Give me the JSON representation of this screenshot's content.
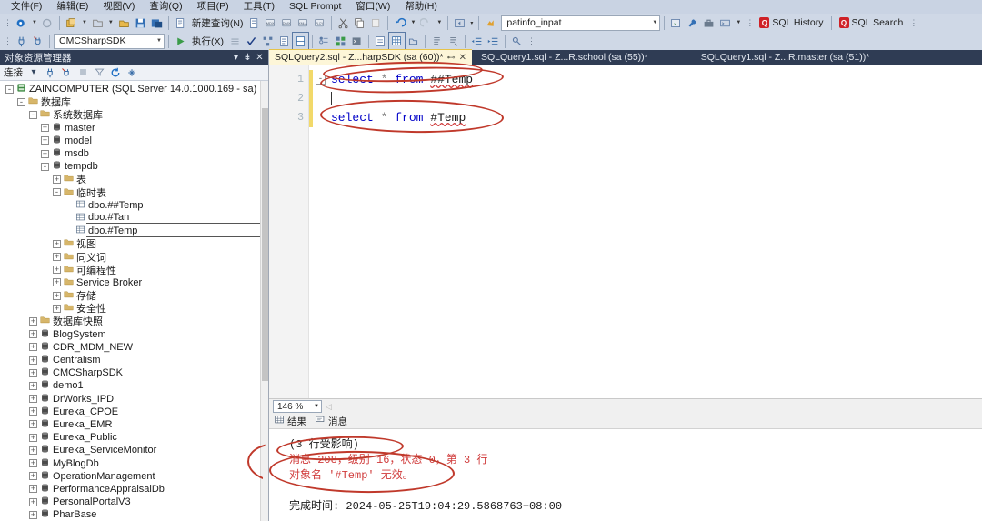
{
  "menubar": {
    "items": [
      {
        "label": "文件(F)",
        "name": "menu-file"
      },
      {
        "label": "编辑(E)",
        "name": "menu-edit"
      },
      {
        "label": "视图(V)",
        "name": "menu-view"
      },
      {
        "label": "查询(Q)",
        "name": "menu-query"
      },
      {
        "label": "项目(P)",
        "name": "menu-project"
      },
      {
        "label": "工具(T)",
        "name": "menu-tools"
      },
      {
        "label": "SQL Prompt",
        "name": "menu-sql-prompt"
      },
      {
        "label": "窗口(W)",
        "name": "menu-window"
      },
      {
        "label": "帮助(H)",
        "name": "menu-help"
      }
    ]
  },
  "toolbar1": {
    "new_query_label": "新建查询(N)",
    "db_combo_value": "patinfo_inpat",
    "sql_history_label": "SQL History",
    "sql_search_label": "SQL Search",
    "sql_badge": "Q"
  },
  "toolbar2": {
    "db_combo_value": "CMCSharpSDK",
    "execute_label": "执行(X)"
  },
  "object_explorer": {
    "title": "对象资源管理器",
    "connect_label": "连接",
    "tree": [
      {
        "indent": 0,
        "expander": "-",
        "icon": "server-icon",
        "label": "ZAINCOMPUTER (SQL Server 14.0.1000.169 - sa)",
        "kind": "srv"
      },
      {
        "indent": 1,
        "expander": "-",
        "icon": "folder-icon",
        "label": "数据库",
        "kind": "fld"
      },
      {
        "indent": 2,
        "expander": "-",
        "icon": "folder-icon",
        "label": "系统数据库",
        "kind": "fld"
      },
      {
        "indent": 3,
        "expander": "+",
        "icon": "database-icon",
        "label": "master",
        "kind": "db"
      },
      {
        "indent": 3,
        "expander": "+",
        "icon": "database-icon",
        "label": "model",
        "kind": "db"
      },
      {
        "indent": 3,
        "expander": "+",
        "icon": "database-icon",
        "label": "msdb",
        "kind": "db"
      },
      {
        "indent": 3,
        "expander": "-",
        "icon": "database-icon",
        "label": "tempdb",
        "kind": "db"
      },
      {
        "indent": 4,
        "expander": "+",
        "icon": "folder-icon",
        "label": "表",
        "kind": "fld"
      },
      {
        "indent": 4,
        "expander": "-",
        "icon": "folder-icon",
        "label": "临时表",
        "kind": "fld"
      },
      {
        "indent": 5,
        "expander": "",
        "icon": "table-icon",
        "label": "dbo.##Temp",
        "kind": "tbl"
      },
      {
        "indent": 5,
        "expander": "",
        "icon": "table-icon",
        "label": "dbo.#Tan",
        "kind": "tbl",
        "underline": true
      },
      {
        "indent": 5,
        "expander": "",
        "icon": "table-icon",
        "label": "dbo.#Temp",
        "kind": "tbl",
        "underline": true
      },
      {
        "indent": 4,
        "expander": "+",
        "icon": "folder-icon",
        "label": "视图",
        "kind": "fld"
      },
      {
        "indent": 4,
        "expander": "+",
        "icon": "folder-icon",
        "label": "同义词",
        "kind": "fld"
      },
      {
        "indent": 4,
        "expander": "+",
        "icon": "folder-icon",
        "label": "可编程性",
        "kind": "fld"
      },
      {
        "indent": 4,
        "expander": "+",
        "icon": "folder-icon",
        "label": "Service Broker",
        "kind": "fld"
      },
      {
        "indent": 4,
        "expander": "+",
        "icon": "folder-icon",
        "label": "存储",
        "kind": "fld"
      },
      {
        "indent": 4,
        "expander": "+",
        "icon": "folder-icon",
        "label": "安全性",
        "kind": "fld"
      },
      {
        "indent": 2,
        "expander": "+",
        "icon": "folder-icon",
        "label": "数据库快照",
        "kind": "fld"
      },
      {
        "indent": 2,
        "expander": "+",
        "icon": "database-icon",
        "label": "BlogSystem",
        "kind": "db"
      },
      {
        "indent": 2,
        "expander": "+",
        "icon": "database-icon",
        "label": "CDR_MDM_NEW",
        "kind": "db"
      },
      {
        "indent": 2,
        "expander": "+",
        "icon": "database-icon",
        "label": "Centralism",
        "kind": "db"
      },
      {
        "indent": 2,
        "expander": "+",
        "icon": "database-icon",
        "label": "CMCSharpSDK",
        "kind": "db"
      },
      {
        "indent": 2,
        "expander": "+",
        "icon": "database-icon",
        "label": "demo1",
        "kind": "db"
      },
      {
        "indent": 2,
        "expander": "+",
        "icon": "database-icon",
        "label": "DrWorks_IPD",
        "kind": "db"
      },
      {
        "indent": 2,
        "expander": "+",
        "icon": "database-icon",
        "label": "Eureka_CPOE",
        "kind": "db"
      },
      {
        "indent": 2,
        "expander": "+",
        "icon": "database-icon",
        "label": "Eureka_EMR",
        "kind": "db"
      },
      {
        "indent": 2,
        "expander": "+",
        "icon": "database-icon",
        "label": "Eureka_Public",
        "kind": "db"
      },
      {
        "indent": 2,
        "expander": "+",
        "icon": "database-icon",
        "label": "Eureka_ServiceMonitor",
        "kind": "db"
      },
      {
        "indent": 2,
        "expander": "+",
        "icon": "database-icon",
        "label": "MyBlogDb",
        "kind": "db"
      },
      {
        "indent": 2,
        "expander": "+",
        "icon": "database-icon",
        "label": "OperationManagement",
        "kind": "db"
      },
      {
        "indent": 2,
        "expander": "+",
        "icon": "database-icon",
        "label": "PerformanceAppraisalDb",
        "kind": "db"
      },
      {
        "indent": 2,
        "expander": "+",
        "icon": "database-icon",
        "label": "PersonalPortalV3",
        "kind": "db"
      },
      {
        "indent": 2,
        "expander": "+",
        "icon": "database-icon",
        "label": "PharBase",
        "kind": "db"
      }
    ]
  },
  "tabs": [
    {
      "label": "SQLQuery2.sql - Z...harpSDK (sa (60))*",
      "active": true,
      "name": "tab-sqlquery2"
    },
    {
      "label": "SQLQuery1.sql - Z...R.school (sa (55))*",
      "active": false,
      "name": "tab-sqlquery1-school"
    },
    {
      "label": "SQLQuery1.sql - Z...R.master (sa (51))*",
      "active": false,
      "name": "tab-sqlquery1-master"
    }
  ],
  "editor": {
    "lines": [
      {
        "num": "1",
        "fold": "-",
        "tokens": [
          {
            "t": "select",
            "c": "kw"
          },
          {
            "t": " ",
            "c": ""
          },
          {
            "t": "*",
            "c": "star"
          },
          {
            "t": " ",
            "c": ""
          },
          {
            "t": "from",
            "c": "kw"
          },
          {
            "t": " ",
            "c": ""
          },
          {
            "t": "##Temp",
            "c": "squig"
          }
        ]
      },
      {
        "num": "2",
        "fold": "",
        "tokens": [],
        "caret": true
      },
      {
        "num": "3",
        "fold": "",
        "tokens": [
          {
            "t": "select",
            "c": "kw"
          },
          {
            "t": " ",
            "c": ""
          },
          {
            "t": "*",
            "c": "star"
          },
          {
            "t": " ",
            "c": ""
          },
          {
            "t": "from",
            "c": "kw"
          },
          {
            "t": " ",
            "c": ""
          },
          {
            "t": "#Temp",
            "c": "squig"
          }
        ]
      }
    ]
  },
  "zoombar": {
    "zoom_value": "146 %"
  },
  "results": {
    "tab_results": "结果",
    "tab_messages": "消息",
    "messages": [
      {
        "text": "(3 行受影响)",
        "error": false
      },
      {
        "text": "消息 208，级别 16，状态 0，第 3 行",
        "error": true
      },
      {
        "text": "对象名 '#Temp' 无效。",
        "error": true
      },
      {
        "text": "",
        "error": false
      },
      {
        "text": "完成时间: 2024-05-25T19:04:29.5868763+08:00",
        "error": false
      }
    ]
  },
  "colors": {
    "accent_dark": "#2f3c54",
    "tab_active": "#fdf6d8",
    "annotation_red": "#c0392b",
    "keyword_blue": "#0000c8",
    "error_red": "#d03b3b",
    "green_underline": "#b5d46a"
  }
}
